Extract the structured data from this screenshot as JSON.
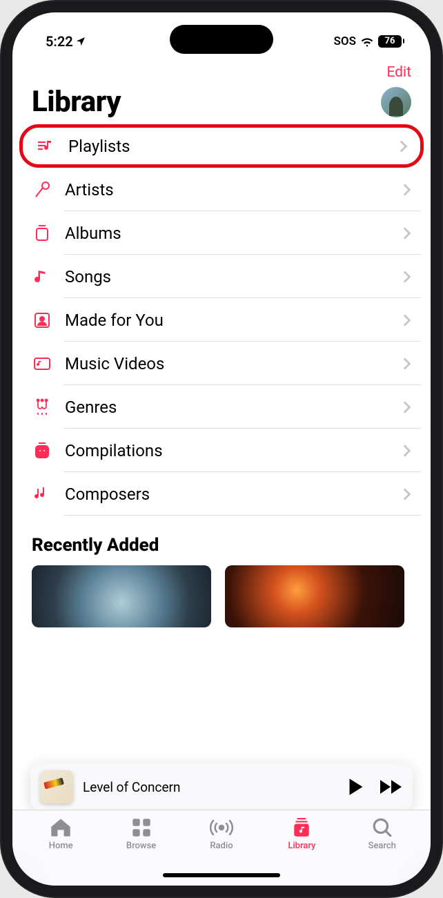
{
  "status_bar": {
    "time": "5:22",
    "sos": "SOS",
    "battery": "76"
  },
  "nav": {
    "edit": "Edit"
  },
  "header": {
    "title": "Library"
  },
  "library_items": [
    {
      "label": "Playlists",
      "icon": "playlists-icon",
      "highlighted": true
    },
    {
      "label": "Artists",
      "icon": "mic-icon"
    },
    {
      "label": "Albums",
      "icon": "album-icon"
    },
    {
      "label": "Songs",
      "icon": "note-icon"
    },
    {
      "label": "Made for You",
      "icon": "person-icon"
    },
    {
      "label": "Music Videos",
      "icon": "video-icon"
    },
    {
      "label": "Genres",
      "icon": "guitar-icon"
    },
    {
      "label": "Compilations",
      "icon": "compilation-icon"
    },
    {
      "label": "Composers",
      "icon": "composers-icon"
    }
  ],
  "recently_added": {
    "title": "Recently Added"
  },
  "mini_player": {
    "track": "Level of Concern"
  },
  "tabs": [
    {
      "label": "Home",
      "icon": "home-icon"
    },
    {
      "label": "Browse",
      "icon": "browse-icon"
    },
    {
      "label": "Radio",
      "icon": "radio-icon"
    },
    {
      "label": "Library",
      "icon": "library-icon",
      "active": true
    },
    {
      "label": "Search",
      "icon": "search-icon"
    }
  ],
  "colors": {
    "accent": "#ff2d55"
  }
}
